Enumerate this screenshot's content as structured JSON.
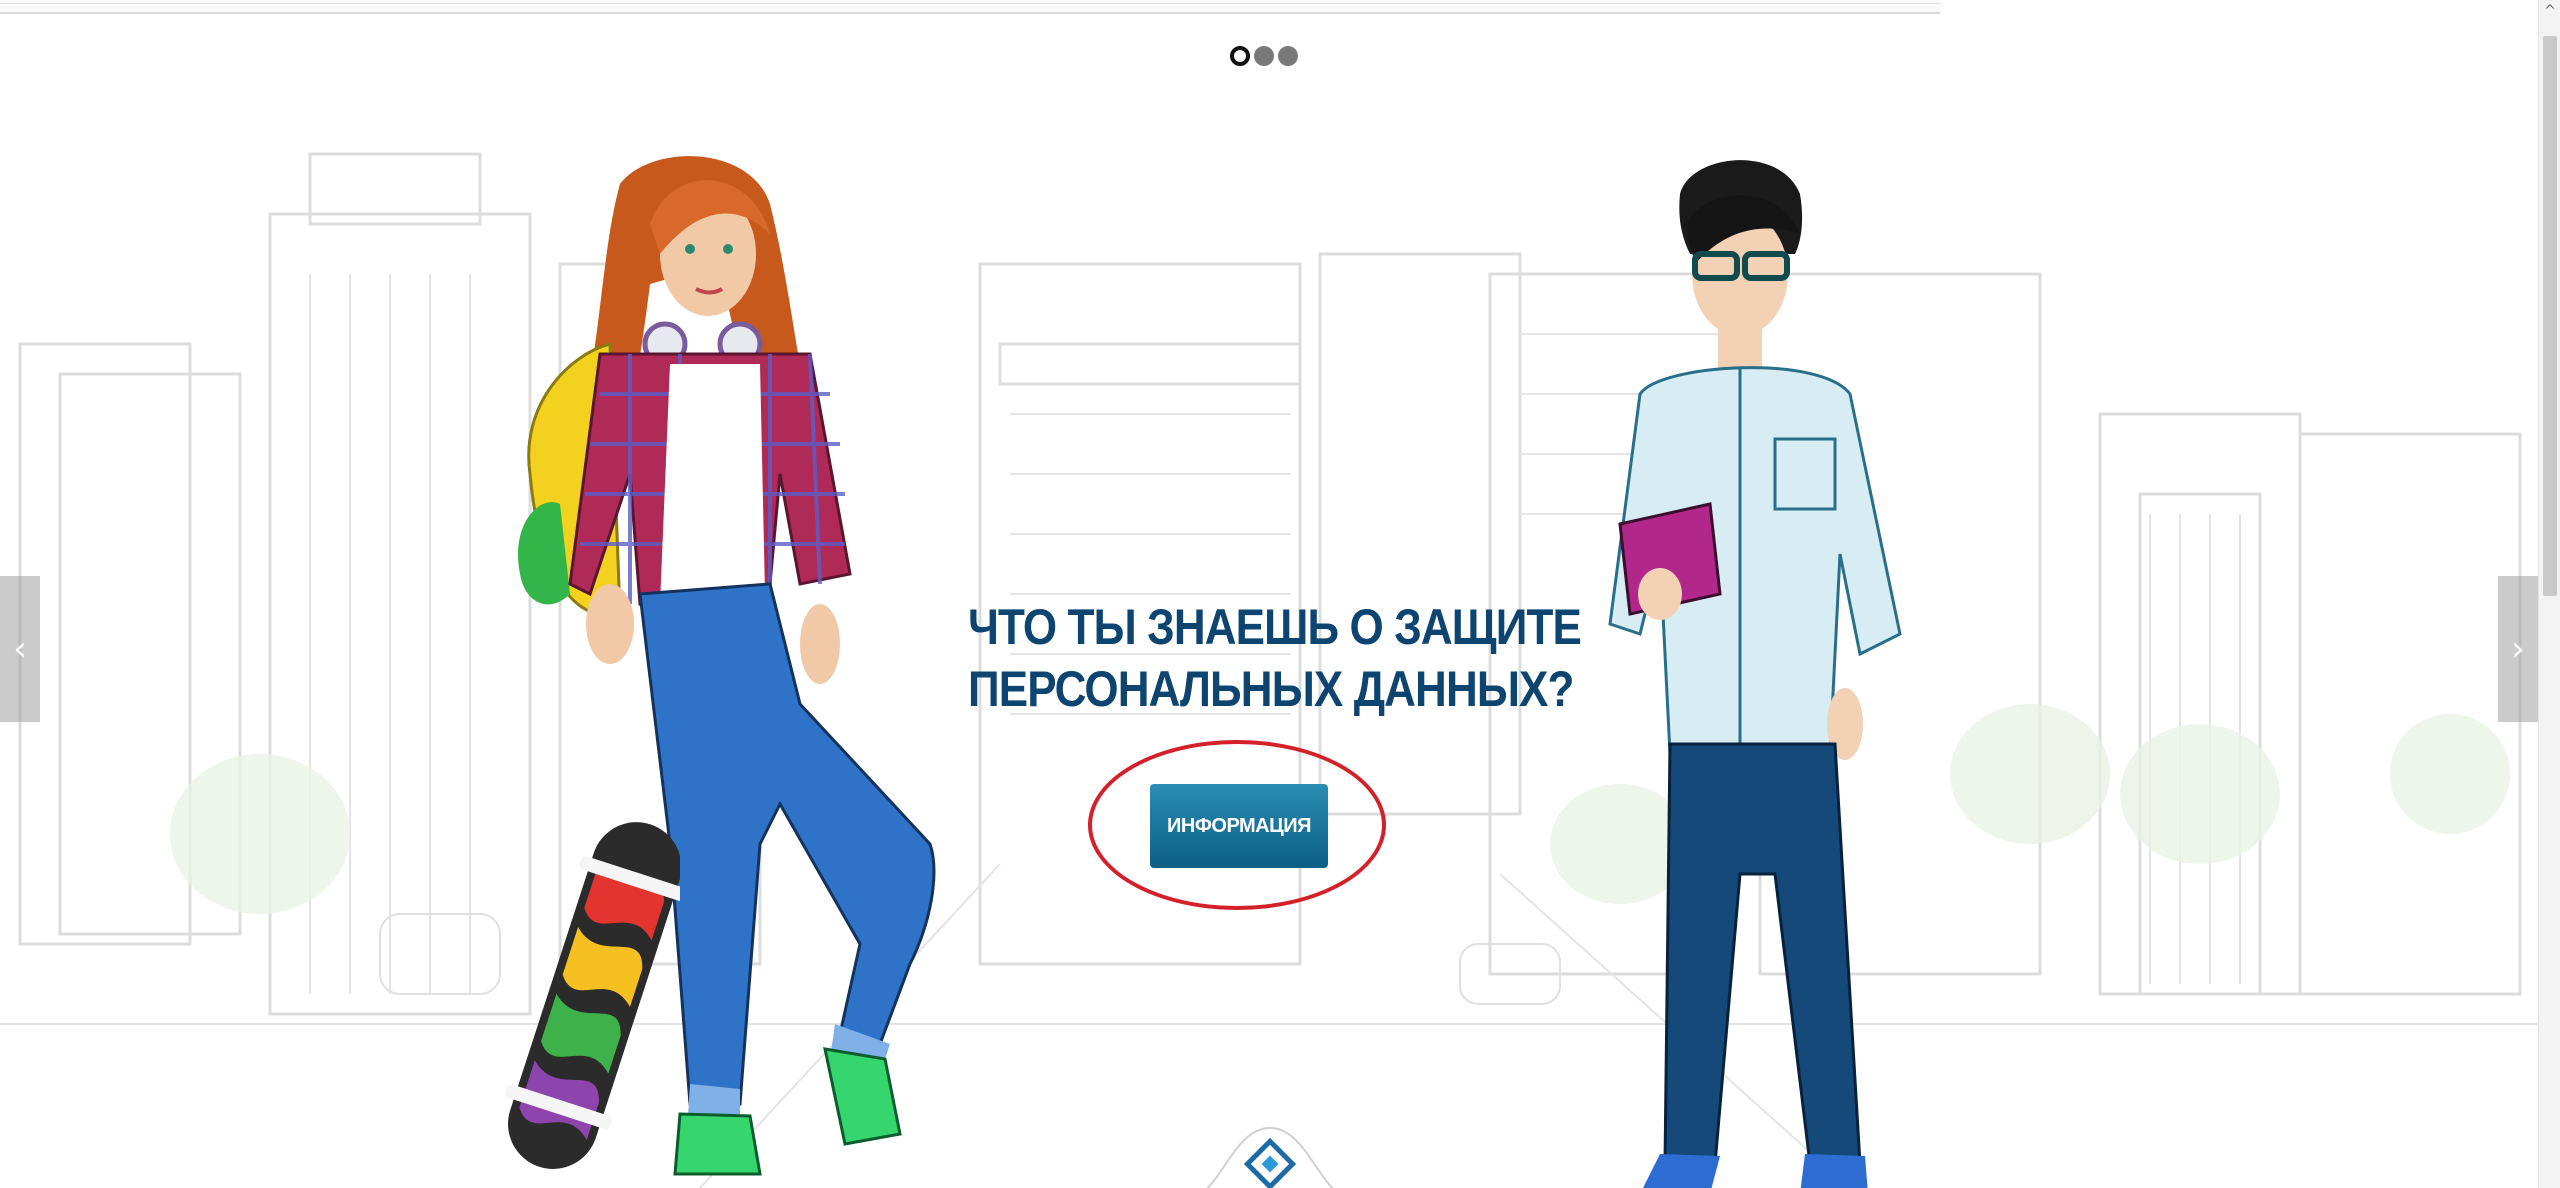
{
  "slider": {
    "dots": [
      {
        "active": true
      },
      {
        "active": false
      },
      {
        "active": false
      }
    ],
    "prev_arrow": "‹",
    "next_arrow": "›"
  },
  "hero": {
    "headline_line1": "ЧТО ТЫ ЗНАЕШЬ О ЗАЩИТЕ",
    "headline_line2": "ПЕРСОНАЛЬНЫХ ДАННЫХ?",
    "button_label": "ИНФОРМАЦИЯ"
  },
  "scrollbar": {
    "up_glyph": "^"
  },
  "colors": {
    "headline": "#0d4470",
    "button": "#0c5f86",
    "highlight": "#d4202a"
  }
}
